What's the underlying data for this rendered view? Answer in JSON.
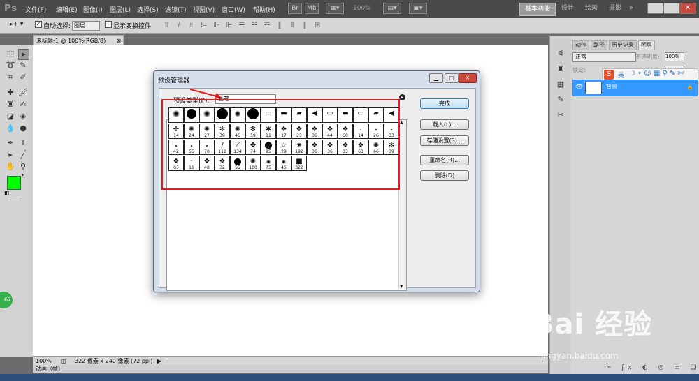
{
  "app": {
    "logo": "Ps"
  },
  "menu": [
    "文件(F)",
    "编辑(E)",
    "图像(I)",
    "图层(L)",
    "选择(S)",
    "滤镜(T)",
    "视图(V)",
    "窗口(W)",
    "帮助(H)"
  ],
  "toolbar_right": {
    "zoom": "100%"
  },
  "workspaces": [
    "基本功能",
    "设计",
    "绘画",
    "摄影"
  ],
  "options": {
    "auto_select_label": "自动选择:",
    "auto_select_value": "图层",
    "show_transform_label": "显示变换控件"
  },
  "document": {
    "tab": "未标题-1 @ 100%(RGB/8)"
  },
  "status": {
    "zoom": "100%",
    "info": "322 像素 x 240 像素 (72 ppi)",
    "animation_tab": "动画（帧）"
  },
  "layers_panel": {
    "tabs": [
      "动作",
      "路径",
      "历史记录",
      "图层"
    ],
    "blend_mode": "正常",
    "opacity_label": "不透明度:",
    "opacity": "100%",
    "lock_label": "锁定:",
    "fill_label": "填充:",
    "fill": "100%",
    "layer_name": "背景",
    "ime": "英"
  },
  "dialog": {
    "title": "预设管理器",
    "preset_type_label": "预设类型(P):",
    "preset_type_value": "画笔",
    "buttons": {
      "done": "完成",
      "load": "载入(L)...",
      "save": "存储设置(S)...",
      "rename": "重命名(R)...",
      "delete": "删除(D)"
    },
    "brushes": [
      {
        "label": "",
        "kind": "soft",
        "size": 10
      },
      {
        "label": "",
        "kind": "hard",
        "size": 14
      },
      {
        "label": "",
        "kind": "soft",
        "size": 10
      },
      {
        "label": "",
        "kind": "hard",
        "size": 16
      },
      {
        "label": "",
        "kind": "soft",
        "size": 9
      },
      {
        "label": "",
        "kind": "hard",
        "size": 16
      },
      {
        "label": "",
        "kind": "shape",
        "glyph": "▭"
      },
      {
        "label": "",
        "kind": "shape",
        "glyph": "▬"
      },
      {
        "label": "",
        "kind": "shape",
        "glyph": "▰"
      },
      {
        "label": "",
        "kind": "shape",
        "glyph": "◀"
      },
      {
        "label": "",
        "kind": "shape",
        "glyph": "▭"
      },
      {
        "label": "",
        "kind": "shape",
        "glyph": "▬"
      },
      {
        "label": "",
        "kind": "shape",
        "glyph": "▭"
      },
      {
        "label": "",
        "kind": "shape",
        "glyph": "▰"
      },
      {
        "label": "",
        "kind": "shape",
        "glyph": "◀"
      },
      {
        "label": "14",
        "kind": "shape",
        "glyph": "✢"
      },
      {
        "label": "24",
        "kind": "shape",
        "glyph": "✺"
      },
      {
        "label": "27",
        "kind": "shape",
        "glyph": "✺"
      },
      {
        "label": "39",
        "kind": "shape",
        "glyph": "✻"
      },
      {
        "label": "46",
        "kind": "shape",
        "glyph": "✺"
      },
      {
        "label": "59",
        "kind": "shape",
        "glyph": "✻"
      },
      {
        "label": "11",
        "kind": "shape",
        "glyph": "✱"
      },
      {
        "label": "17",
        "kind": "shape",
        "glyph": "❖"
      },
      {
        "label": "23",
        "kind": "shape",
        "glyph": "❖"
      },
      {
        "label": "36",
        "kind": "shape",
        "glyph": "❖"
      },
      {
        "label": "44",
        "kind": "shape",
        "glyph": "❖"
      },
      {
        "label": "60",
        "kind": "shape",
        "glyph": "❖"
      },
      {
        "label": "14",
        "kind": "soft",
        "size": 2
      },
      {
        "label": "26",
        "kind": "soft",
        "size": 3
      },
      {
        "label": "33",
        "kind": "soft",
        "size": 3
      },
      {
        "label": "42",
        "kind": "soft",
        "size": 3
      },
      {
        "label": "55",
        "kind": "soft",
        "size": 3
      },
      {
        "label": "70",
        "kind": "soft",
        "size": 3
      },
      {
        "label": "112",
        "kind": "shape",
        "glyph": "/"
      },
      {
        "label": "134",
        "kind": "shape",
        "glyph": "⟋"
      },
      {
        "label": "74",
        "kind": "shape",
        "glyph": "✥"
      },
      {
        "label": "95",
        "kind": "shape",
        "glyph": "⬤"
      },
      {
        "label": "29",
        "kind": "shape",
        "glyph": "☆"
      },
      {
        "label": "192",
        "kind": "shape",
        "glyph": "✷"
      },
      {
        "label": "36",
        "kind": "shape",
        "glyph": "❖"
      },
      {
        "label": "36",
        "kind": "shape",
        "glyph": "❖"
      },
      {
        "label": "33",
        "kind": "shape",
        "glyph": "❖"
      },
      {
        "label": "63",
        "kind": "shape",
        "glyph": "❖"
      },
      {
        "label": "66",
        "kind": "shape",
        "glyph": "✺"
      },
      {
        "label": "39",
        "kind": "shape",
        "glyph": "✻"
      },
      {
        "label": "63",
        "kind": "shape",
        "glyph": "❖"
      },
      {
        "label": "11",
        "kind": "shape",
        "glyph": "·"
      },
      {
        "label": "48",
        "kind": "shape",
        "glyph": "❖"
      },
      {
        "label": "32",
        "kind": "shape",
        "glyph": "❖"
      },
      {
        "label": "55",
        "kind": "hard",
        "size": 10
      },
      {
        "label": "100",
        "kind": "shape",
        "glyph": "✺"
      },
      {
        "label": "75",
        "kind": "soft",
        "size": 6
      },
      {
        "label": "45",
        "kind": "soft",
        "size": 6
      },
      {
        "label": "322",
        "kind": "shape",
        "glyph": "■"
      }
    ]
  },
  "watermark": {
    "brand": "Bai 经验",
    "url": "jingyan.baidu.com"
  },
  "badge": "67",
  "colors": {
    "foreground": "#00ff00",
    "background": "#ffffff",
    "annotation": "#e02020",
    "selection": "#3399ff"
  }
}
